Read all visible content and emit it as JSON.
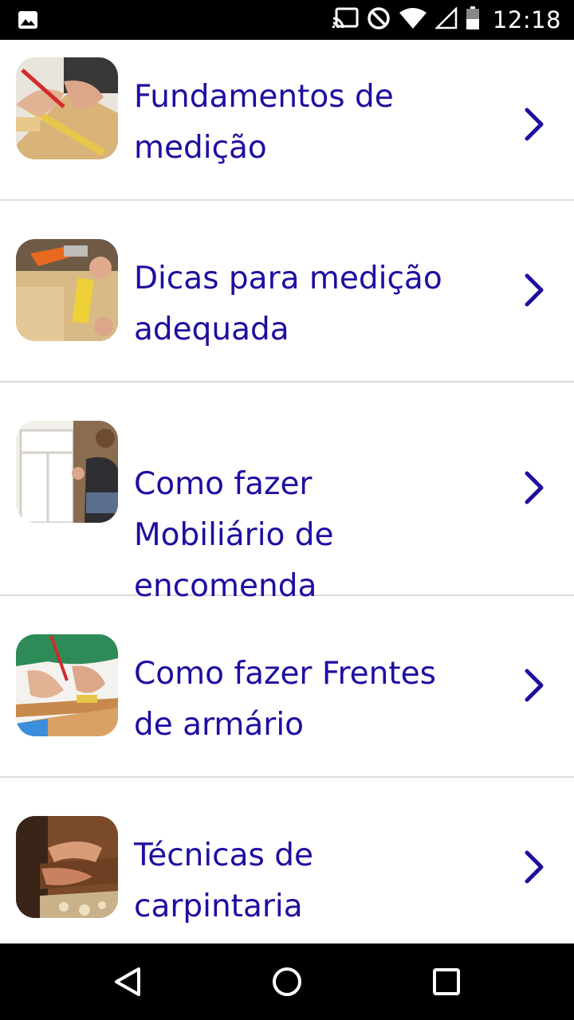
{
  "status_bar": {
    "time": "12:18",
    "icons": [
      "image-icon",
      "cast-icon",
      "do-not-disturb-icon",
      "wifi-icon",
      "cell-signal-icon",
      "battery-icon"
    ]
  },
  "items": [
    {
      "title": "Fundamentos de\nmedição",
      "thumbnail": "measuring-tape-wood-image",
      "chevron": "chevron-right-icon"
    },
    {
      "title": "Dicas para medição\nadequada",
      "thumbnail": "tape-measure-closeup-image",
      "chevron": "chevron-right-icon"
    },
    {
      "title": "Como fazer\nMobiliário de\nencomenda",
      "thumbnail": "cabinet-installation-image",
      "chevron": "chevron-right-icon"
    },
    {
      "title": "Como fazer Frentes\nde armário",
      "thumbnail": "marking-wood-image",
      "chevron": "chevron-right-icon"
    },
    {
      "title": "Técnicas de\ncarpintaria",
      "thumbnail": "hand-plane-image",
      "chevron": "chevron-right-icon"
    }
  ],
  "nav_bar": {
    "buttons": [
      "back-icon",
      "home-icon",
      "recents-icon"
    ]
  },
  "colors": {
    "title_text": "#1e0ea0",
    "chevron": "#1e0ea0",
    "divider": "#dddddd",
    "bars": "#000000"
  }
}
